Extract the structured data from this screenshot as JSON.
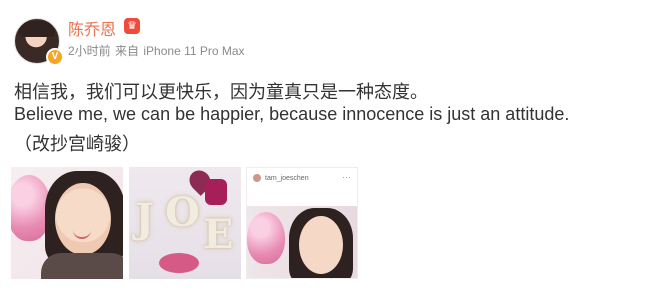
{
  "user": {
    "name": "陈乔恩",
    "verified_badge": "V",
    "vip_icon": "crown-icon"
  },
  "meta": {
    "time": "2小时前",
    "from_label": "来自",
    "device": "iPhone 11 Pro Max"
  },
  "post": {
    "text_zh": "相信我，我们可以更快乐，因为童真只是一种态度。",
    "text_en": "Believe me, we can be happier, because innocence is just an attitude.",
    "text_credit": "（改抄宫崎骏）"
  },
  "images": [
    {
      "name": "photo-woman-balloon"
    },
    {
      "name": "photo-joe-letters",
      "letters": [
        "J",
        "O",
        "E"
      ]
    },
    {
      "name": "photo-instagram-screenshot",
      "post_username": "tam_joeschen",
      "post_more": "···"
    }
  ]
}
